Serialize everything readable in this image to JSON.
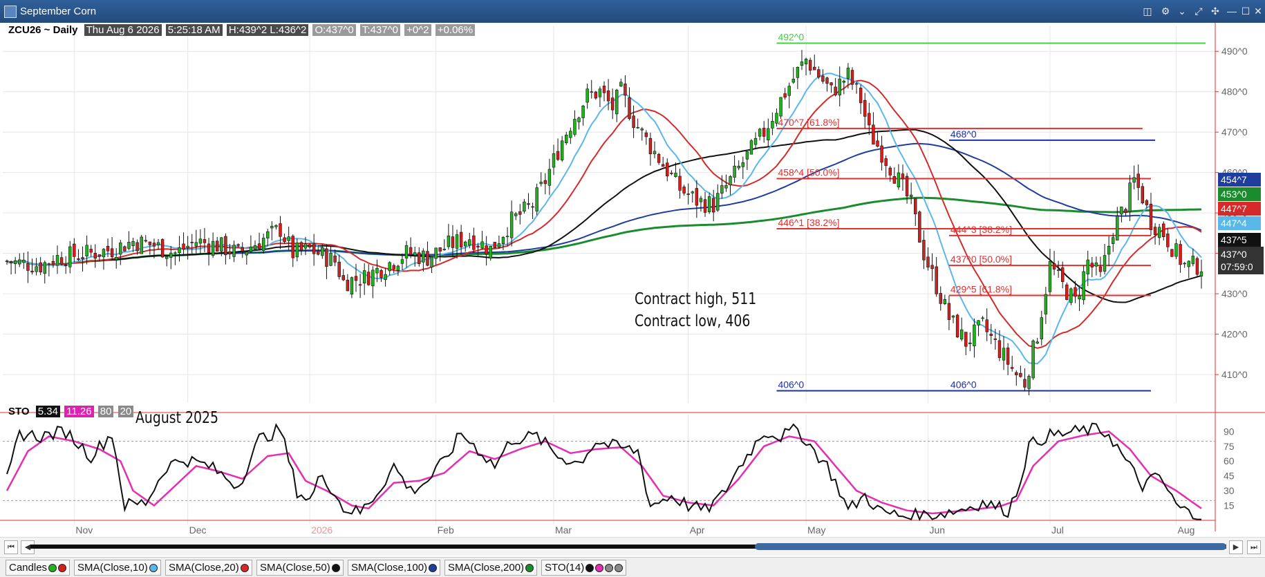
{
  "window": {
    "title": "September Corn",
    "controls": [
      "◫",
      "⚙",
      "⌄",
      "⤢",
      "✣",
      "—",
      "☐",
      "✕"
    ]
  },
  "header": {
    "symbol": "ZCU26 ~ Daily",
    "date": "Thu Aug 6 2026",
    "time": "5:25:18 AM",
    "hl": "H:439^2  L:436^2",
    "open": "O:437^0",
    "trade": "T:437^0",
    "change": "+0^2",
    "pct": "+0.06%"
  },
  "annotations": {
    "contract_high": "Contract high, 511",
    "contract_low": "Contract low, 406",
    "sto_note": "August 2025"
  },
  "sto_header": {
    "label": "STO",
    "k": "5.34",
    "d": "11.26",
    "upper": "80",
    "lower": "20"
  },
  "colors": {
    "up": "#22b11f",
    "down": "#d41f1f",
    "sma10": "#5bb6ea",
    "sma20": "#d42a2a",
    "sma50": "#111111",
    "sma100": "#1f3d9c",
    "sma200": "#1a8c2e",
    "fib": "#e03030",
    "line492": "#3fd03f",
    "navy": "#1f2fa6",
    "sto_k": "#111111",
    "sto_d": "#e52eb0"
  },
  "scrollbar": {
    "left": "⏮",
    "prev": "◀",
    "next": "▶",
    "right": "⏭"
  },
  "studies": [
    {
      "label": "Candles",
      "dots": [
        "#22b11f",
        "#d41f1f"
      ]
    },
    {
      "label": "SMA(Close,10)",
      "dots": [
        "#5bb6ea"
      ]
    },
    {
      "label": "SMA(Close,20)",
      "dots": [
        "#d42a2a"
      ]
    },
    {
      "label": "SMA(Close,50)",
      "dots": [
        "#111111"
      ]
    },
    {
      "label": "SMA(Close,100)",
      "dots": [
        "#1f3d9c"
      ]
    },
    {
      "label": "SMA(Close,200)",
      "dots": [
        "#1a8c2e"
      ]
    },
    {
      "label": "STO(14)",
      "dots": [
        "#111111",
        "#e52eb0",
        "#8a8a8a",
        "#8a8a8a"
      ]
    }
  ],
  "chart_data": {
    "type": "candlestick",
    "title": "September Corn",
    "price_axis": {
      "min": 403,
      "max": 495,
      "ticks": [
        410,
        420,
        430,
        440,
        450,
        460,
        470,
        480,
        490
      ],
      "tick_labels": [
        "410^0",
        "420^0",
        "430^0",
        "440^0",
        "450^0",
        "460^0",
        "470^0",
        "480^0",
        "490^0"
      ]
    },
    "x_axis": {
      "dates": [
        "Nov",
        "Dec",
        "2026",
        "Feb",
        "Mar",
        "Apr",
        "May",
        "Jun",
        "Jul",
        "Aug"
      ],
      "date_index": [
        16,
        43,
        72,
        102,
        130,
        162,
        190,
        219,
        248,
        278
      ]
    },
    "candle_count": 285,
    "price_anchors": [
      [
        0,
        438
      ],
      [
        8,
        437
      ],
      [
        12,
        439
      ],
      [
        20,
        440
      ],
      [
        25,
        441
      ],
      [
        30,
        443
      ],
      [
        35,
        442
      ],
      [
        40,
        440
      ],
      [
        45,
        443
      ],
      [
        50,
        442
      ],
      [
        55,
        440
      ],
      [
        60,
        443
      ],
      [
        65,
        446
      ],
      [
        68,
        440
      ],
      [
        72,
        441
      ],
      [
        78,
        438
      ],
      [
        80,
        433
      ],
      [
        85,
        434
      ],
      [
        90,
        437
      ],
      [
        95,
        440
      ],
      [
        100,
        439
      ],
      [
        105,
        442
      ],
      [
        110,
        444
      ],
      [
        115,
        441
      ],
      [
        120,
        448
      ],
      [
        125,
        452
      ],
      [
        128,
        458
      ],
      [
        132,
        468
      ],
      [
        135,
        474
      ],
      [
        138,
        479
      ],
      [
        141,
        480
      ],
      [
        144,
        476
      ],
      [
        146,
        480
      ],
      [
        149,
        473
      ],
      [
        152,
        468
      ],
      [
        156,
        462
      ],
      [
        160,
        456
      ],
      [
        164,
        453
      ],
      [
        168,
        452
      ],
      [
        172,
        458
      ],
      [
        176,
        464
      ],
      [
        180,
        470
      ],
      [
        184,
        478
      ],
      [
        188,
        485
      ],
      [
        190,
        488
      ],
      [
        193,
        484
      ],
      [
        196,
        480
      ],
      [
        200,
        484
      ],
      [
        203,
        478
      ],
      [
        205,
        470
      ],
      [
        208,
        465
      ],
      [
        212,
        458
      ],
      [
        215,
        452
      ],
      [
        218,
        440
      ],
      [
        221,
        432
      ],
      [
        224,
        424
      ],
      [
        228,
        418
      ],
      [
        232,
        422
      ],
      [
        236,
        416
      ],
      [
        240,
        410
      ],
      [
        242,
        408
      ],
      [
        245,
        420
      ],
      [
        248,
        437
      ],
      [
        251,
        432
      ],
      [
        254,
        428
      ],
      [
        257,
        438
      ],
      [
        260,
        434
      ],
      [
        263,
        446
      ],
      [
        266,
        452
      ],
      [
        268,
        458
      ],
      [
        270,
        454
      ],
      [
        272,
        448
      ],
      [
        275,
        445
      ],
      [
        278,
        440
      ],
      [
        280,
        437
      ],
      [
        284,
        437
      ]
    ],
    "sma_last": {
      "sma10": "447^4",
      "sma20": "447^7",
      "sma50": "437^5",
      "sma100": "454^7",
      "sma200": "453^0"
    },
    "last_price": {
      "value": "437^0",
      "timer": "07:59:0"
    },
    "levels": [
      {
        "label": "492^0",
        "value": 492,
        "from": 183,
        "to": 285,
        "color": "#3fd03f"
      },
      {
        "label": "470^7 [61.8%]",
        "value": 470.9,
        "from": 183,
        "to": 270,
        "color": "#e03030"
      },
      {
        "label": "468^0",
        "value": 468,
        "from": 224,
        "to": 273,
        "color": "#1f2fa6"
      },
      {
        "label": "458^4 [50.0%]",
        "value": 458.5,
        "from": 183,
        "to": 272,
        "color": "#e03030"
      },
      {
        "label": "446^1 [38.2%]",
        "value": 446.1,
        "from": 183,
        "to": 272,
        "color": "#e03030"
      },
      {
        "label": "444^3 [38.2%]",
        "value": 444.4,
        "from": 224,
        "to": 272,
        "color": "#e03030"
      },
      {
        "label": "437^0 [50.0%]",
        "value": 437,
        "from": 224,
        "to": 272,
        "color": "#e03030"
      },
      {
        "label": "429^5 [61.8%]",
        "value": 429.6,
        "from": 224,
        "to": 272,
        "color": "#e03030"
      },
      {
        "label": "406^0",
        "value": 406,
        "from": 183,
        "to": 226,
        "color": "#1f2fa6"
      },
      {
        "label": "406^0",
        "value": 406,
        "from": 224,
        "to": 272,
        "color": "#1f2fa6"
      }
    ],
    "sto": {
      "min": 0,
      "max": 100,
      "ticks": [
        15,
        30,
        45,
        60,
        75,
        90
      ],
      "bands": [
        80,
        20
      ],
      "k_anchors": [
        [
          0,
          40
        ],
        [
          3,
          88
        ],
        [
          8,
          85
        ],
        [
          14,
          90
        ],
        [
          20,
          65
        ],
        [
          25,
          88
        ],
        [
          28,
          15
        ],
        [
          33,
          18
        ],
        [
          38,
          55
        ],
        [
          42,
          62
        ],
        [
          48,
          55
        ],
        [
          55,
          35
        ],
        [
          60,
          82
        ],
        [
          65,
          92
        ],
        [
          69,
          30
        ],
        [
          72,
          20
        ],
        [
          75,
          48
        ],
        [
          80,
          12
        ],
        [
          84,
          8
        ],
        [
          88,
          28
        ],
        [
          92,
          55
        ],
        [
          96,
          30
        ],
        [
          100,
          40
        ],
        [
          104,
          60
        ],
        [
          108,
          88
        ],
        [
          112,
          72
        ],
        [
          116,
          55
        ],
        [
          120,
          82
        ],
        [
          126,
          85
        ],
        [
          131,
          65
        ],
        [
          136,
          58
        ],
        [
          140,
          80
        ],
        [
          144,
          75
        ],
        [
          150,
          70
        ],
        [
          153,
          15
        ],
        [
          158,
          25
        ],
        [
          162,
          15
        ],
        [
          166,
          10
        ],
        [
          170,
          25
        ],
        [
          175,
          60
        ],
        [
          180,
          90
        ],
        [
          184,
          85
        ],
        [
          188,
          92
        ],
        [
          192,
          70
        ],
        [
          195,
          55
        ],
        [
          198,
          30
        ],
        [
          200,
          10
        ],
        [
          204,
          25
        ],
        [
          208,
          8
        ],
        [
          214,
          4
        ],
        [
          220,
          6
        ],
        [
          226,
          10
        ],
        [
          232,
          18
        ],
        [
          238,
          10
        ],
        [
          240,
          28
        ],
        [
          243,
          75
        ],
        [
          247,
          85
        ],
        [
          252,
          88
        ],
        [
          258,
          92
        ],
        [
          262,
          88
        ],
        [
          266,
          60
        ],
        [
          270,
          35
        ],
        [
          274,
          45
        ],
        [
          278,
          15
        ],
        [
          282,
          5
        ],
        [
          284,
          5
        ]
      ],
      "d_anchors": [
        [
          0,
          30
        ],
        [
          5,
          70
        ],
        [
          10,
          85
        ],
        [
          16,
          80
        ],
        [
          22,
          72
        ],
        [
          27,
          60
        ],
        [
          30,
          30
        ],
        [
          35,
          15
        ],
        [
          40,
          35
        ],
        [
          45,
          55
        ],
        [
          50,
          50
        ],
        [
          56,
          42
        ],
        [
          62,
          65
        ],
        [
          67,
          68
        ],
        [
          71,
          40
        ],
        [
          76,
          30
        ],
        [
          82,
          15
        ],
        [
          86,
          12
        ],
        [
          92,
          38
        ],
        [
          98,
          40
        ],
        [
          104,
          48
        ],
        [
          110,
          70
        ],
        [
          116,
          62
        ],
        [
          122,
          72
        ],
        [
          128,
          80
        ],
        [
          134,
          68
        ],
        [
          140,
          72
        ],
        [
          146,
          74
        ],
        [
          151,
          55
        ],
        [
          156,
          25
        ],
        [
          162,
          18
        ],
        [
          168,
          15
        ],
        [
          174,
          42
        ],
        [
          180,
          75
        ],
        [
          186,
          85
        ],
        [
          192,
          80
        ],
        [
          197,
          55
        ],
        [
          202,
          30
        ],
        [
          208,
          18
        ],
        [
          214,
          10
        ],
        [
          220,
          7
        ],
        [
          228,
          10
        ],
        [
          236,
          14
        ],
        [
          240,
          20
        ],
        [
          244,
          55
        ],
        [
          250,
          80
        ],
        [
          256,
          86
        ],
        [
          262,
          90
        ],
        [
          267,
          72
        ],
        [
          272,
          45
        ],
        [
          278,
          30
        ],
        [
          284,
          12
        ]
      ]
    }
  }
}
